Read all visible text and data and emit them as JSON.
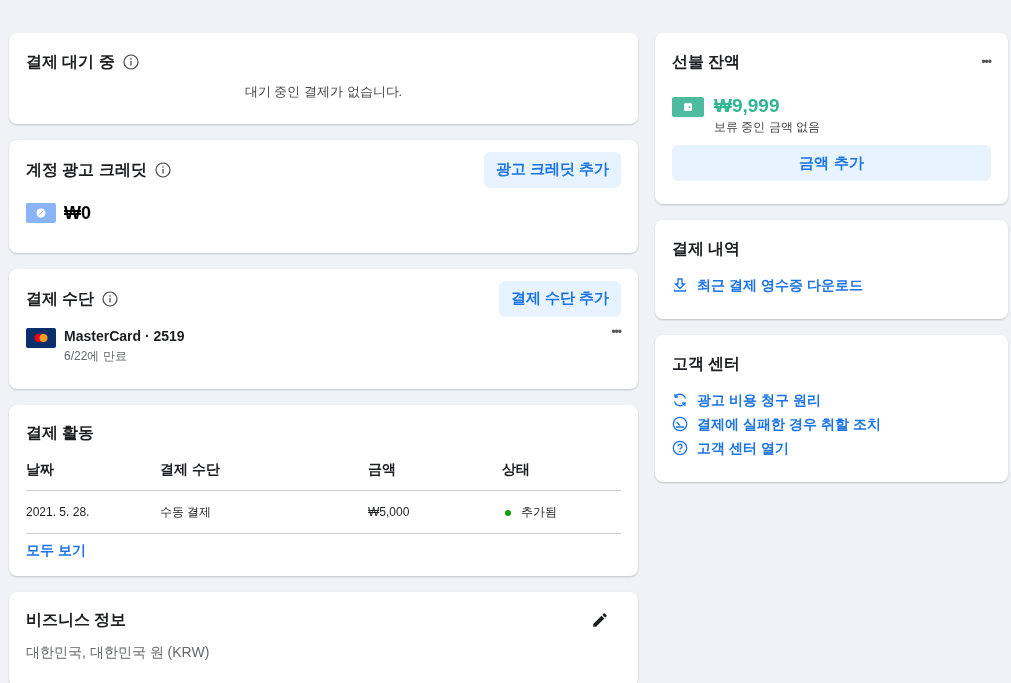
{
  "pending_payments": {
    "title": "결제 대기 중",
    "message": "대기 중인 결제가 없습니다."
  },
  "ad_credit": {
    "title": "계정 광고 크레딧",
    "button": "광고 크레딧 추가",
    "amount": "₩0"
  },
  "payment_methods": {
    "title": "결제 수단",
    "button": "결제 수단 추가",
    "cards": [
      {
        "name": "MasterCard · 2519",
        "expiry": "6/22에 만료",
        "menu": "•••"
      }
    ]
  },
  "payment_activity": {
    "title": "결제 활동",
    "columns": [
      "날짜",
      "결제 수단",
      "금액",
      "상태"
    ],
    "rows": [
      {
        "date": "2021. 5. 28.",
        "method": "수동 결제",
        "amount": "₩5,000",
        "status": "추가됨",
        "color": "#0a9e0a"
      }
    ],
    "link": "모두 보기"
  },
  "business_info": {
    "title": "비즈니스 정보",
    "details": "대한민국, 대한민국 원 (KRW)"
  },
  "prepaid_balance": {
    "title": "선불 잔액",
    "menu": "•••",
    "amount": "₩9,999",
    "note": "보류 중인 금액 없음",
    "button": "금액 추가"
  },
  "payment_history": {
    "title": "결제 내역",
    "links": [
      {
        "kind": "download",
        "label": "최근 결제 영수증 다운로드"
      }
    ]
  },
  "help_center": {
    "title": "고객 센터",
    "links": [
      {
        "kind": "refresh",
        "label": "광고 비용 청구 원리"
      },
      {
        "kind": "gauge",
        "label": "결제에 실패한 경우 취할 조치"
      },
      {
        "kind": "question",
        "label": "고객 센터 열기"
      }
    ]
  }
}
